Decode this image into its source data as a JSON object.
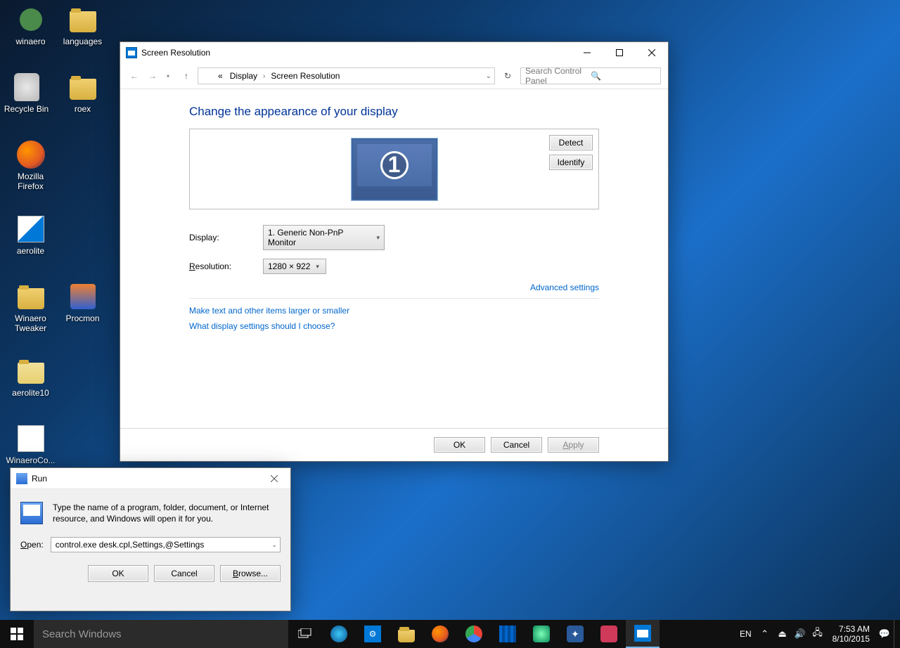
{
  "desktop": {
    "icons": [
      {
        "label": "winaero"
      },
      {
        "label": "languages"
      },
      {
        "label": "Recycle Bin"
      },
      {
        "label": "roex"
      },
      {
        "label": "Mozilla Firefox"
      },
      {
        "label": "aerolite"
      },
      {
        "label": "Winaero Tweaker"
      },
      {
        "label": "Procmon"
      },
      {
        "label": "aerolite10"
      },
      {
        "label": "WinaeroCo..."
      }
    ]
  },
  "screenres": {
    "title": "Screen Resolution",
    "breadcrumb": {
      "prev": "Display",
      "current": "Screen Resolution",
      "prefix": "«"
    },
    "search_placeholder": "Search Control Panel",
    "heading": "Change the appearance of your display",
    "detect": "Detect",
    "identify": "Identify",
    "display_label": "Display:",
    "display_value": "1. Generic Non-PnP Monitor",
    "resolution_label": "Resolution:",
    "resolution_value": "1280 × 922",
    "advanced": "Advanced settings",
    "link1": "Make text and other items larger or smaller",
    "link2": "What display settings should I choose?",
    "ok": "OK",
    "cancel": "Cancel",
    "apply": "Apply",
    "monitor_number": "1"
  },
  "run": {
    "title": "Run",
    "description": "Type the name of a program, folder, document, or Internet resource, and Windows will open it for you.",
    "open_label": "Open:",
    "open_value": "control.exe desk.cpl,Settings,@Settings",
    "ok": "OK",
    "cancel": "Cancel",
    "browse": "Browse..."
  },
  "taskbar": {
    "search_placeholder": "Search Windows",
    "lang": "EN",
    "time": "7:53 AM",
    "date": "8/10/2015"
  }
}
